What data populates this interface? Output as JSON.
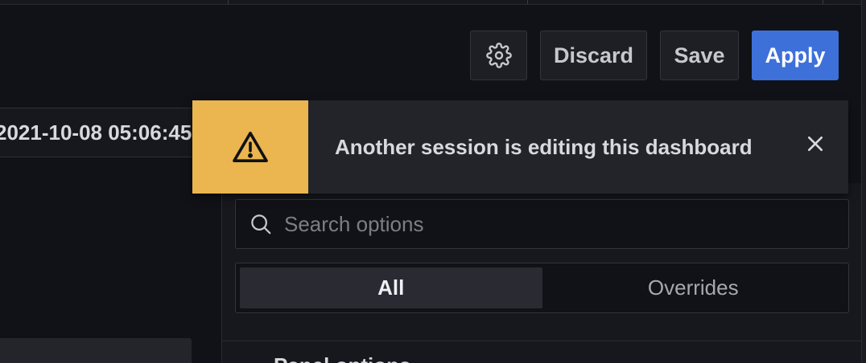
{
  "toolbar": {
    "settings_icon": "gear-icon",
    "discard_label": "Discard",
    "save_label": "Save",
    "apply_label": "Apply"
  },
  "time_range": {
    "value": "2021-10-08 05:06:45"
  },
  "alert": {
    "severity": "warning",
    "icon": "warning-triangle-icon",
    "message": "Another session is editing this dashboard",
    "close_icon": "close-icon",
    "accent_color": "#ebb54f"
  },
  "options_pane": {
    "search": {
      "icon": "search-icon",
      "placeholder": "Search options",
      "value": ""
    },
    "tabs": [
      {
        "label": "All",
        "active": true
      },
      {
        "label": "Overrides",
        "active": false
      }
    ],
    "section_title_partial": "Panel options"
  },
  "colors": {
    "background": "#111217",
    "primary": "#3d71d9",
    "warning": "#ebb54f"
  }
}
